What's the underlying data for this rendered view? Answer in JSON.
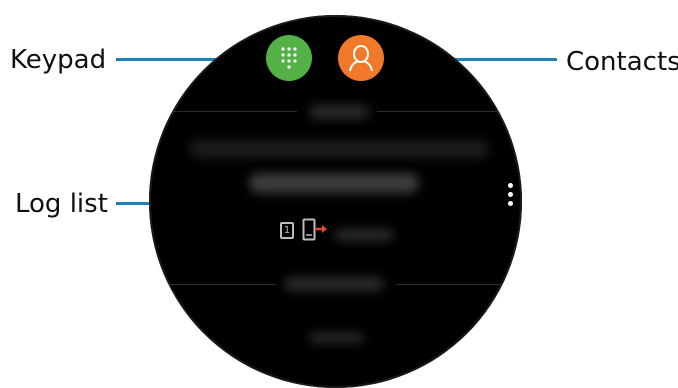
{
  "labels": {
    "keypad": "Keypad",
    "contacts": "Contacts",
    "log_list": "Log list"
  },
  "watch": {
    "keypad_button": {
      "icon": "dialpad-icon",
      "color": "#53b146"
    },
    "contacts_button": {
      "icon": "person-icon",
      "color": "#f07a2a"
    },
    "log_item": {
      "sim_badge": "1",
      "call_icon": "outgoing-call-icon",
      "arrow_color": "#e24a33"
    },
    "more_icon": "more-vertical-icon"
  },
  "colors": {
    "callout_line": "#1d80b8",
    "watch_background": "#000000"
  }
}
